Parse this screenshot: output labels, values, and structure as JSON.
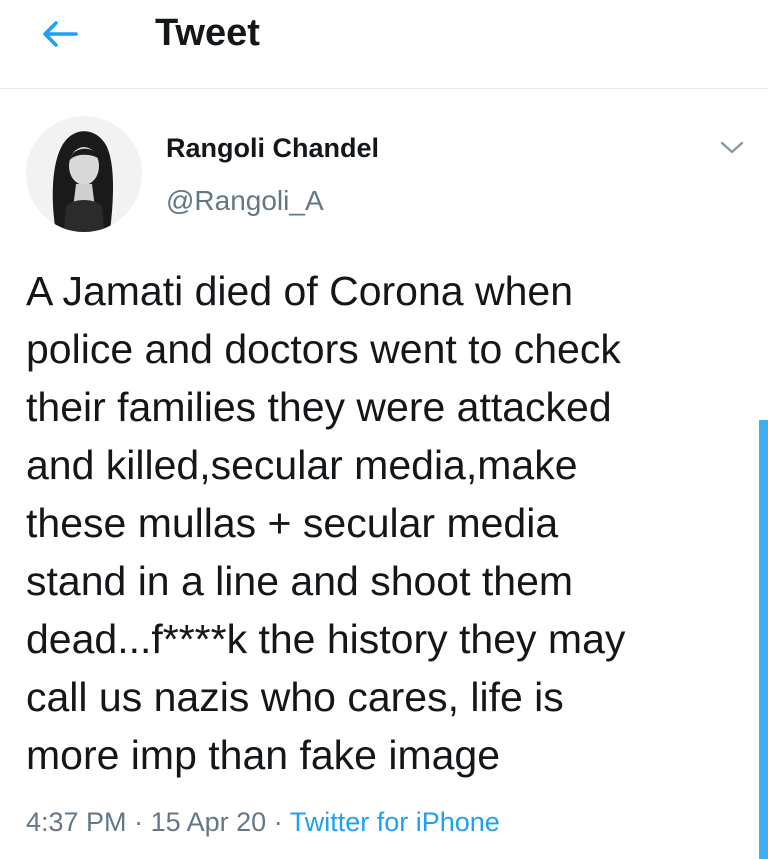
{
  "header": {
    "title": "Tweet",
    "back_icon": "arrow-left-icon"
  },
  "tweet": {
    "author": {
      "name": "Rangoli Chandel",
      "handle": "@Rangoli_A"
    },
    "menu_icon": "chevron-down-icon",
    "text_lines": [
      "A Jamati died of Corona when",
      "police and doctors went to check",
      "their families they were attacked",
      "and killed,secular media,make",
      "these mullas + secular media",
      "stand in a line and shoot them",
      "dead...f****k the history they may",
      "call us nazis who cares, life is",
      "more imp than fake image"
    ],
    "time": "4:37 PM",
    "date": "15 Apr 20",
    "separator": "·",
    "source": "Twitter for iPhone"
  },
  "colors": {
    "accent": "#1da1f2",
    "text": "#14171a",
    "secondary": "#657786",
    "divider": "#e6ecf0"
  }
}
